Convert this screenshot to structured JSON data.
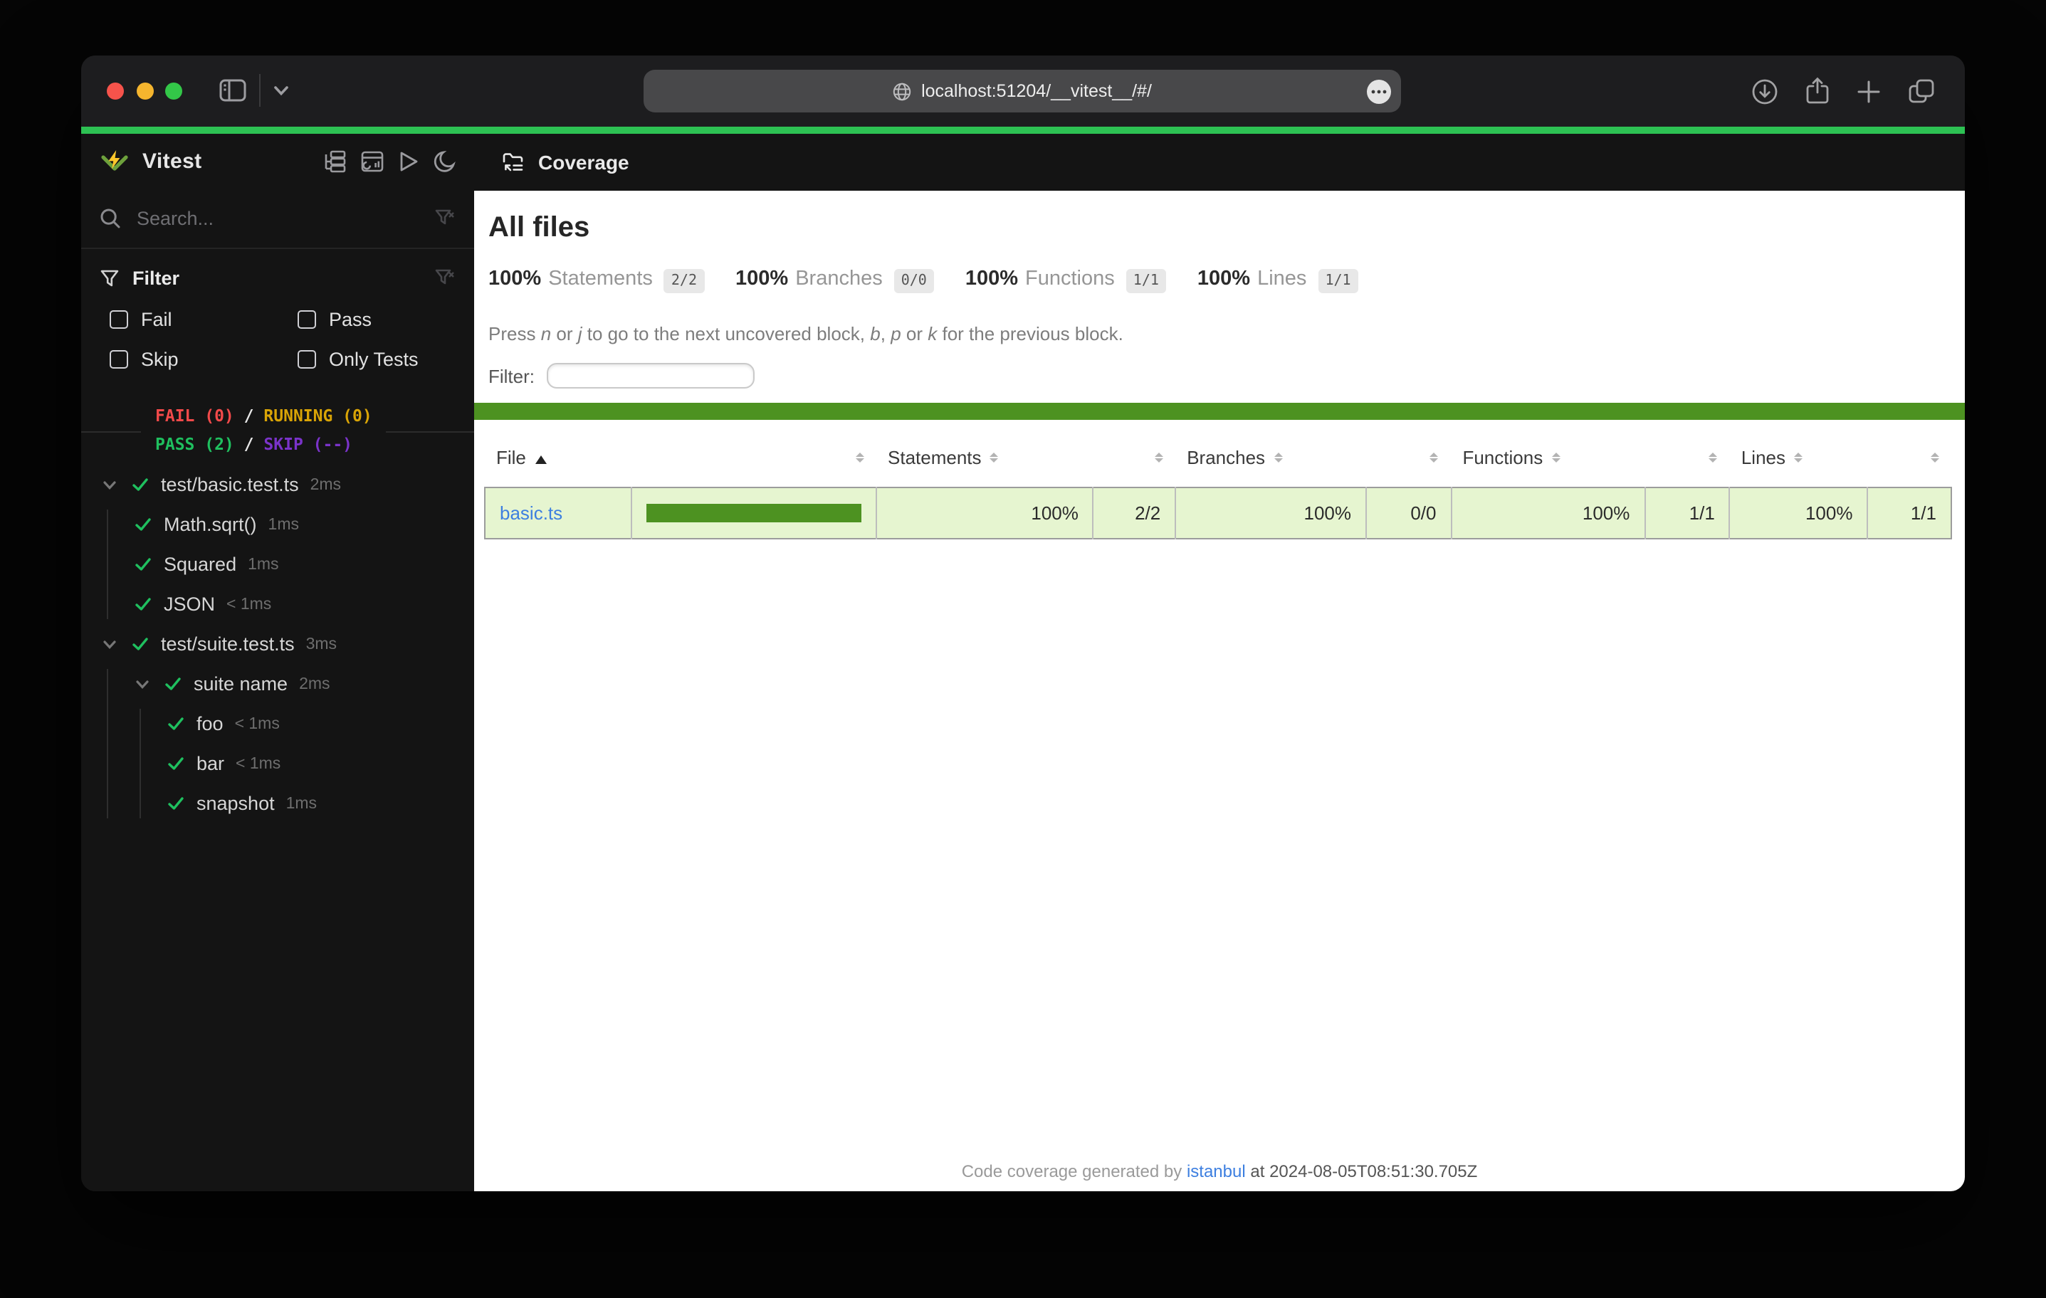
{
  "colors": {
    "vitest_accent_green": "#2dc153",
    "coverage_green": "#4d9221",
    "coverage_row_bg": "#e6f5d0",
    "link_blue": "#3d7fe0",
    "fail_red": "#f24a4a",
    "running_yellow": "#d9a406",
    "pass_green": "#1fc05f",
    "skip_purple": "#7a33c9",
    "logo_green": "#6da13c",
    "logo_yellow": "#fcc72b"
  },
  "browser": {
    "url": "localhost:51204/__vitest__/#/"
  },
  "sidebar": {
    "brand": "Vitest",
    "search_placeholder": "Search...",
    "filter": {
      "title": "Filter",
      "options": [
        "Fail",
        "Pass",
        "Skip",
        "Only Tests"
      ]
    },
    "status": {
      "fail": "FAIL (0)",
      "running": "RUNNING (0)",
      "pass": "PASS (2)",
      "skip": "SKIP (--)",
      "separator": "/"
    },
    "tree": [
      {
        "label": "test/basic.test.ts",
        "duration": "2ms",
        "depth": 0,
        "expandable": true
      },
      {
        "label": "Math.sqrt()",
        "duration": "1ms",
        "depth": 1
      },
      {
        "label": "Squared",
        "duration": "1ms",
        "depth": 1
      },
      {
        "label": "JSON",
        "duration": "< 1ms",
        "depth": 1
      },
      {
        "label": "test/suite.test.ts",
        "duration": "3ms",
        "depth": 0,
        "expandable": true
      },
      {
        "label": "suite name",
        "duration": "2ms",
        "depth": 1,
        "expandable": true
      },
      {
        "label": "foo",
        "duration": "< 1ms",
        "depth": 2
      },
      {
        "label": "bar",
        "duration": "< 1ms",
        "depth": 2
      },
      {
        "label": "snapshot",
        "duration": "1ms",
        "depth": 2
      }
    ]
  },
  "main": {
    "header_title": "Coverage",
    "page_title": "All files",
    "summary": [
      {
        "pct": "100%",
        "label": "Statements",
        "fraction": "2/2"
      },
      {
        "pct": "100%",
        "label": "Branches",
        "fraction": "0/0"
      },
      {
        "pct": "100%",
        "label": "Functions",
        "fraction": "1/1"
      },
      {
        "pct": "100%",
        "label": "Lines",
        "fraction": "1/1"
      }
    ],
    "hint": [
      {
        "t": "Press "
      },
      {
        "t": "n",
        "i": true
      },
      {
        "t": " or "
      },
      {
        "t": "j",
        "i": true
      },
      {
        "t": " to go to the next uncovered block, "
      },
      {
        "t": "b",
        "i": true
      },
      {
        "t": ", "
      },
      {
        "t": "p",
        "i": true
      },
      {
        "t": " or "
      },
      {
        "t": "k",
        "i": true
      },
      {
        "t": " for the previous block."
      }
    ],
    "filter_label": "Filter:",
    "table": {
      "headers": {
        "file": "File",
        "statements": "Statements",
        "branches": "Branches",
        "functions": "Functions",
        "lines": "Lines"
      },
      "rows": [
        {
          "file": "basic.ts",
          "bar_pct": 100,
          "statements_pct": "100%",
          "statements": "2/2",
          "branches_pct": "100%",
          "branches": "0/0",
          "functions_pct": "100%",
          "functions": "1/1",
          "lines_pct": "100%",
          "lines": "1/1"
        }
      ]
    },
    "footer": {
      "prefix": "Code coverage generated by ",
      "link": "istanbul",
      "middle": " at ",
      "timestamp": "2024-08-05T08:51:30.705Z"
    }
  }
}
